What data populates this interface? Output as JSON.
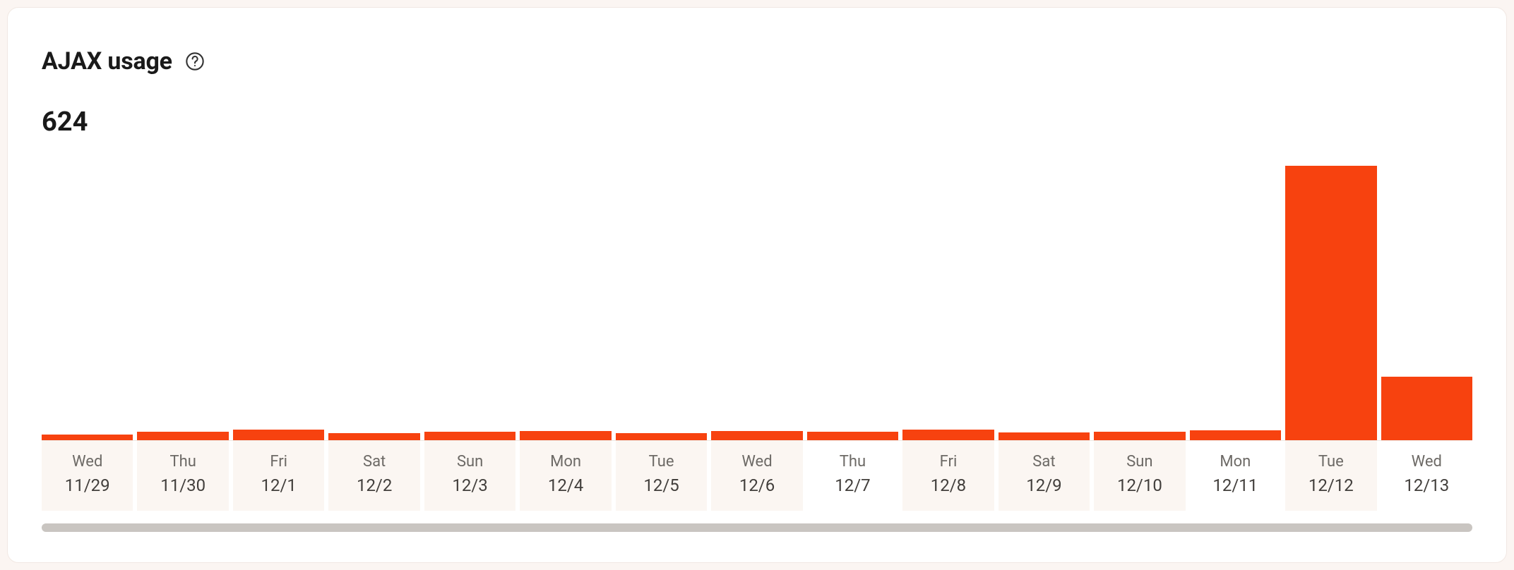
{
  "header": {
    "title": "AJAX usage"
  },
  "total": "624",
  "colors": {
    "bar": "#f7420f"
  },
  "chart_data": {
    "type": "bar",
    "title": "AJAX usage",
    "xlabel": "",
    "ylabel": "",
    "ylim": [
      0,
      400
    ],
    "categories": [
      "Wed 11/29",
      "Thu 11/30",
      "Fri 12/1",
      "Sat 12/2",
      "Sun 12/3",
      "Mon 12/4",
      "Tue 12/5",
      "Wed 12/6",
      "Thu 12/7",
      "Fri 12/8",
      "Sat 12/9",
      "Sun 12/10",
      "Mon 12/11",
      "Tue 12/12",
      "Wed 12/13"
    ],
    "values": [
      4,
      12,
      15,
      10,
      12,
      13,
      10,
      13,
      12,
      15,
      11,
      12,
      14,
      390,
      90
    ],
    "days": [
      {
        "dow": "Wed",
        "date": "11/29",
        "value": 4,
        "shade": true
      },
      {
        "dow": "Thu",
        "date": "11/30",
        "value": 12,
        "shade": true
      },
      {
        "dow": "Fri",
        "date": "12/1",
        "value": 15,
        "shade": true
      },
      {
        "dow": "Sat",
        "date": "12/2",
        "value": 10,
        "shade": true
      },
      {
        "dow": "Sun",
        "date": "12/3",
        "value": 12,
        "shade": true
      },
      {
        "dow": "Mon",
        "date": "12/4",
        "value": 13,
        "shade": true
      },
      {
        "dow": "Tue",
        "date": "12/5",
        "value": 10,
        "shade": true
      },
      {
        "dow": "Wed",
        "date": "12/6",
        "value": 13,
        "shade": true
      },
      {
        "dow": "Thu",
        "date": "12/7",
        "value": 12,
        "shade": false
      },
      {
        "dow": "Fri",
        "date": "12/8",
        "value": 15,
        "shade": true
      },
      {
        "dow": "Sat",
        "date": "12/9",
        "value": 11,
        "shade": true
      },
      {
        "dow": "Sun",
        "date": "12/10",
        "value": 12,
        "shade": true
      },
      {
        "dow": "Mon",
        "date": "12/11",
        "value": 14,
        "shade": false
      },
      {
        "dow": "Tue",
        "date": "12/12",
        "value": 390,
        "shade": true
      },
      {
        "dow": "Wed",
        "date": "12/13",
        "value": 90,
        "shade": false
      }
    ]
  }
}
